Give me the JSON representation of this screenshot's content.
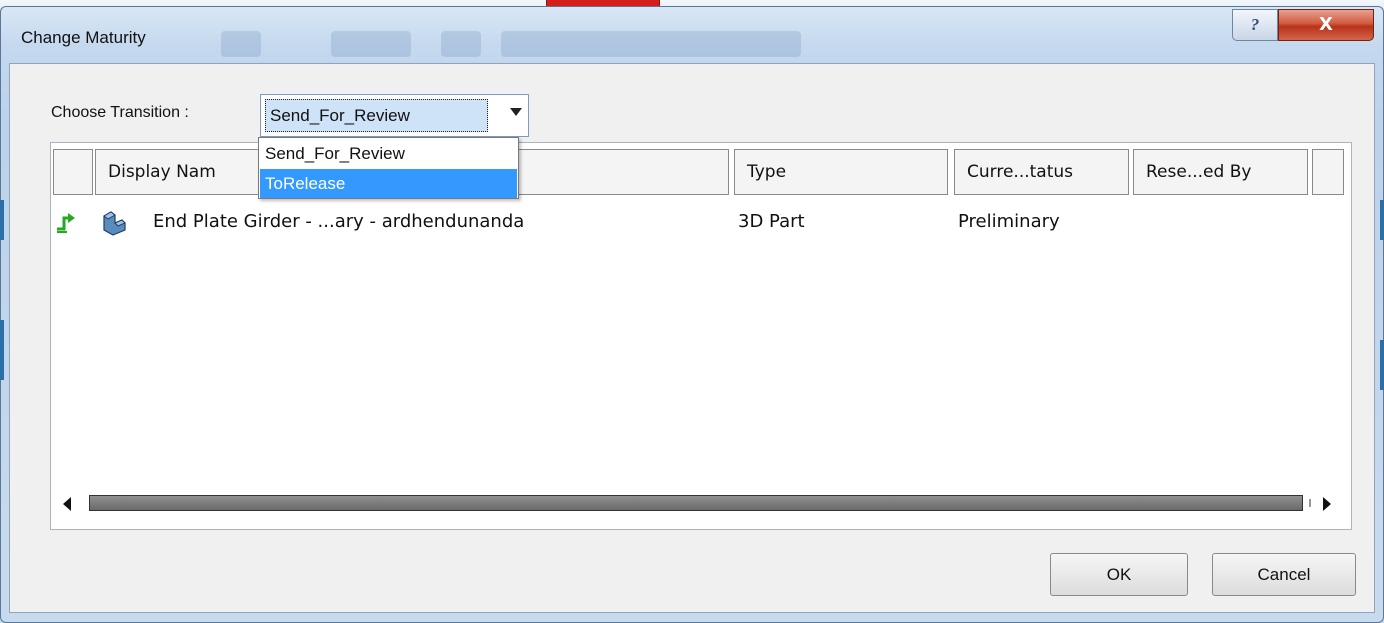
{
  "window": {
    "title": "Change Maturity",
    "help_glyph": "?",
    "close_glyph": "X"
  },
  "transition": {
    "label": "Choose Transition :",
    "selected": "Send_For_Review",
    "options": [
      "Send_For_Review",
      "ToRelease"
    ],
    "highlighted_option": "ToRelease"
  },
  "table": {
    "columns": [
      "",
      "Display Nam",
      "Type",
      "Curre...tatus",
      "Rese...ed By",
      ""
    ],
    "rows": [
      {
        "display_name": "End Plate Girder  -  ...ary  -  ardhendunanda",
        "type": "3D Part",
        "current_status": "Preliminary",
        "reserved_by": ""
      }
    ]
  },
  "buttons": {
    "ok": "OK",
    "cancel": "Cancel"
  },
  "colors": {
    "selection_highlight": "#3399ff",
    "close_button": "#c8452a",
    "row_transition_icon": "#22aa22",
    "part_icon": "#4a78a8"
  },
  "icons": {
    "row_status": "transition-arrow-icon",
    "row_type": "3d-part-icon"
  }
}
